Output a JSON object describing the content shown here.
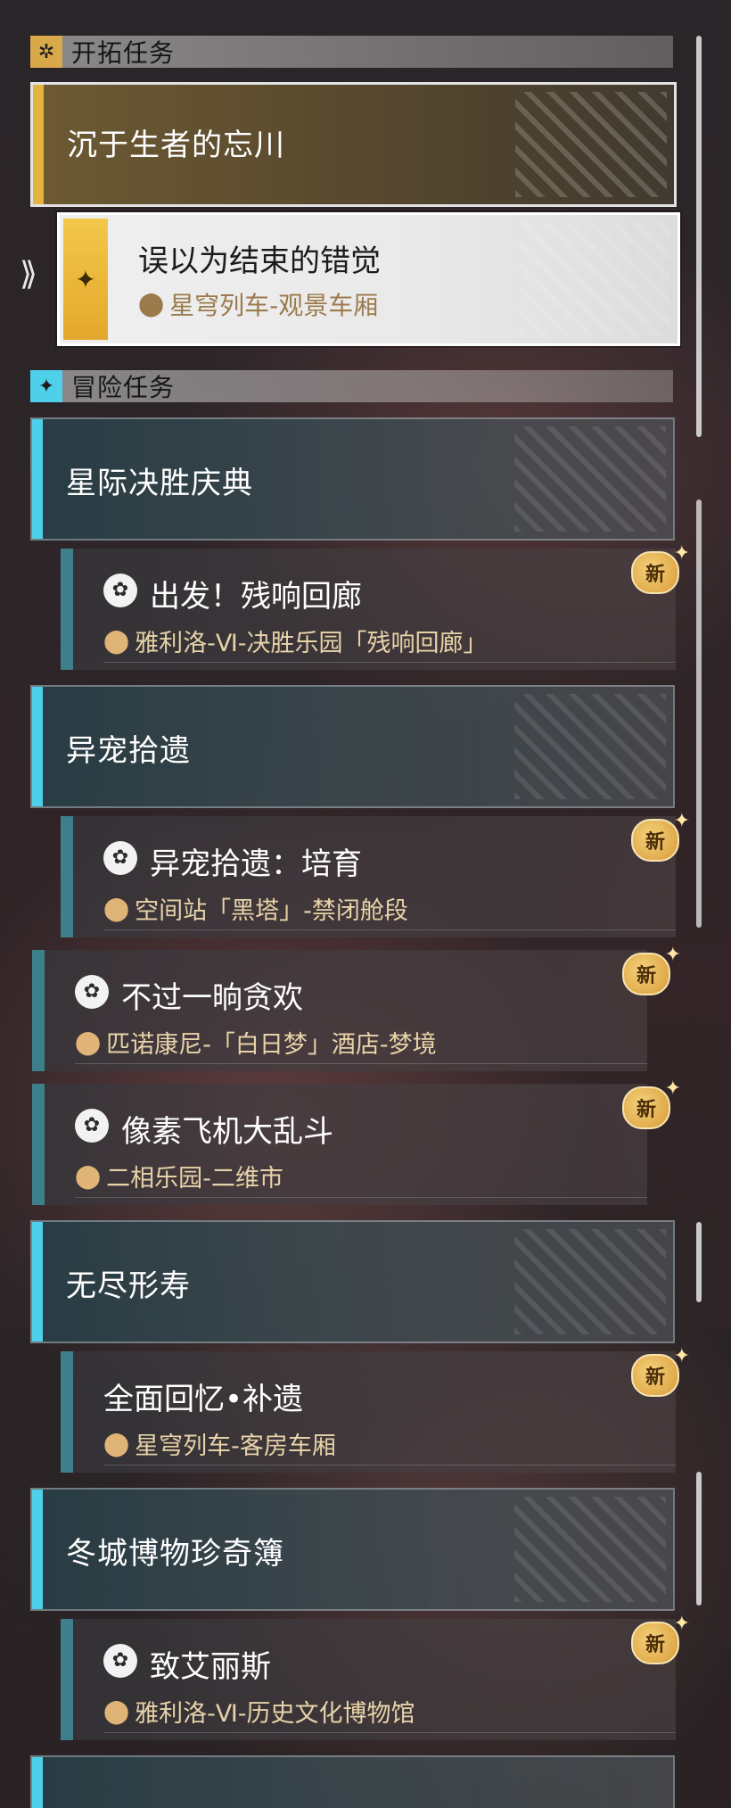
{
  "pioneer": {
    "header_icon": "sparkle-icon",
    "header": "开拓任务",
    "chapter_title": "沉于生者的忘川",
    "selected_quest": {
      "title": "误以为结束的错觉",
      "location": "星穹列车-观景车厢",
      "tab_color": "#e4b43e"
    }
  },
  "adventure": {
    "header_icon": "compass-star-icon",
    "header": "冒险任务",
    "accent_color": "#4fd0ea",
    "new_badge": "新",
    "categories": [
      {
        "title": "星际决胜庆典",
        "quests": [
          {
            "title": "出发！残响回廊",
            "location": "雅利洛-Ⅵ-决胜乐园「残响回廊」",
            "icon": "puzzle-quest-icon",
            "new": true
          }
        ]
      },
      {
        "title": "异宠拾遗",
        "quests": [
          {
            "title": "异宠拾遗：培育",
            "location": "空间站「黑塔」-禁闭舱段",
            "icon": "puzzle-quest-icon",
            "new": true
          },
          {
            "title": "不过一晌贪欢",
            "location": "匹诺康尼-「白日梦」酒店-梦境",
            "icon": "puzzle-quest-icon",
            "new": true
          },
          {
            "title": "像素飞机大乱斗",
            "location": "二相乐园-二维市",
            "icon": "puzzle-quest-icon",
            "new": true
          }
        ]
      },
      {
        "title": "无尽形寿",
        "quests": [
          {
            "title": "全面回忆•补遗",
            "location": "星穹列车-客房车厢",
            "icon": "",
            "new": true
          }
        ]
      },
      {
        "title": "冬城博物珍奇簿",
        "quests": [
          {
            "title": "致艾丽斯",
            "location": "雅利洛-Ⅵ-历史文化博物馆",
            "icon": "puzzle-quest-icon",
            "new": true
          }
        ]
      }
    ]
  }
}
